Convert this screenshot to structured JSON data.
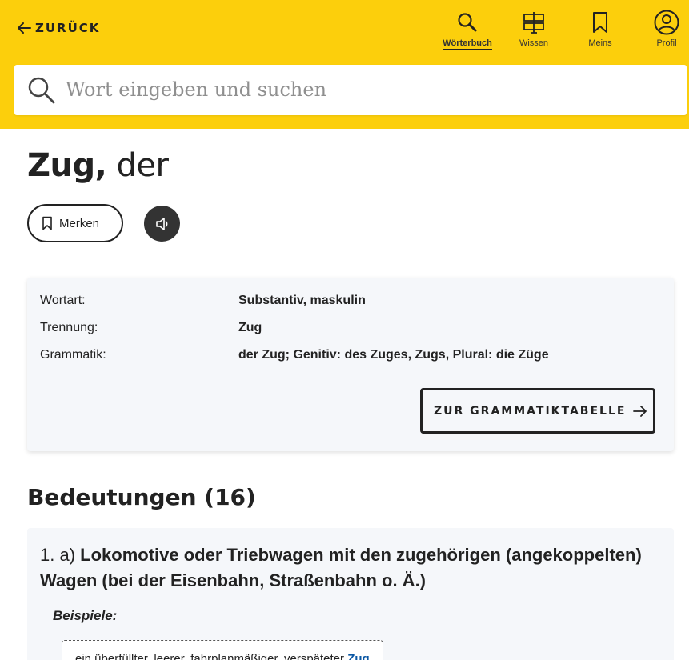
{
  "header": {
    "back_label": "ZURÜCK",
    "nav": [
      {
        "label": "Wörterbuch",
        "icon": "search-icon",
        "active": true
      },
      {
        "label": "Wissen",
        "icon": "signpost-icon",
        "active": false
      },
      {
        "label": "Meins",
        "icon": "bookmark-icon",
        "active": false
      },
      {
        "label": "Profil",
        "icon": "user-icon",
        "active": false
      }
    ],
    "search_placeholder": "Wort eingeben und suchen"
  },
  "entry": {
    "lemma": "Zug,",
    "article": " der",
    "merken_label": "Merken"
  },
  "info": {
    "rows": [
      {
        "key": "Wortart:",
        "value": "Substantiv, maskulin"
      },
      {
        "key": "Trennung:",
        "value": "Zug"
      },
      {
        "key": "Grammatik:",
        "value": "der Zug; Genitiv: des Zuges, Zugs, Plural: die Züge"
      }
    ],
    "grammar_button": "ZUR GRAMMATIKTABELLE"
  },
  "meanings": {
    "title": "Bedeutungen (16)",
    "first": {
      "number": "1. a)",
      "definition": "Lokomotive oder Triebwagen mit den zugehörigen (angekoppelten) Wagen (bei der Eisenbahn, Straßenbahn o. Ä.)",
      "examples_label": "Beispiele:",
      "example_text": "ein überfüllter, leerer, fahrplanmäßiger, verspäteter ",
      "example_highlight": "Zug"
    }
  },
  "colors": {
    "brand_yellow": "#fccf0c",
    "card_bg": "#f5f7fa",
    "link_blue": "#0b57a4",
    "dark": "#222222"
  }
}
